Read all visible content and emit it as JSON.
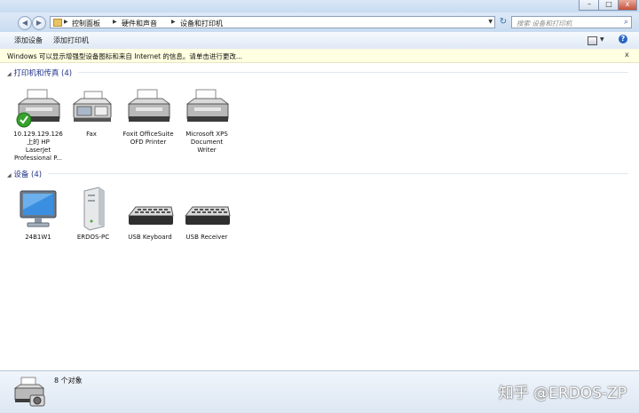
{
  "breadcrumb": [
    "控制面板",
    "硬件和声音",
    "设备和打印机"
  ],
  "search": {
    "placeholder": "搜索 设备和打印机"
  },
  "toolbar": {
    "add_device": "添加设备",
    "add_printer": "添加打印机"
  },
  "infobar": {
    "message": "Windows 可以显示增强型设备图标和来自 Internet 的信息。请单击进行更改...",
    "close": "x"
  },
  "groups": {
    "printers": {
      "title": "打印机和传真 (4)"
    },
    "devices": {
      "title": "设备 (4)"
    }
  },
  "printers": [
    {
      "label": "10.129.129.126\n上的 HP\nLaserJet\nProfessional P...",
      "icon": "printer-default-icon"
    },
    {
      "label": "Fax",
      "icon": "fax-icon"
    },
    {
      "label": "Foxit OfficeSuite\nOFD Printer",
      "icon": "printer-icon"
    },
    {
      "label": "Microsoft XPS\nDocument\nWriter",
      "icon": "printer-icon"
    }
  ],
  "devices": [
    {
      "label": "24B1W1",
      "icon": "monitor-icon"
    },
    {
      "label": "ERDOS-PC",
      "icon": "computer-tower-icon"
    },
    {
      "label": "USB Keyboard",
      "icon": "keyboard-icon"
    },
    {
      "label": "USB Receiver",
      "icon": "keyboard-icon"
    }
  ],
  "status": {
    "count": "8 个对象"
  },
  "watermark": "知乎 @ERDOS-ZP",
  "window": {
    "minimize": "–",
    "maximize": "□",
    "close": "x"
  }
}
